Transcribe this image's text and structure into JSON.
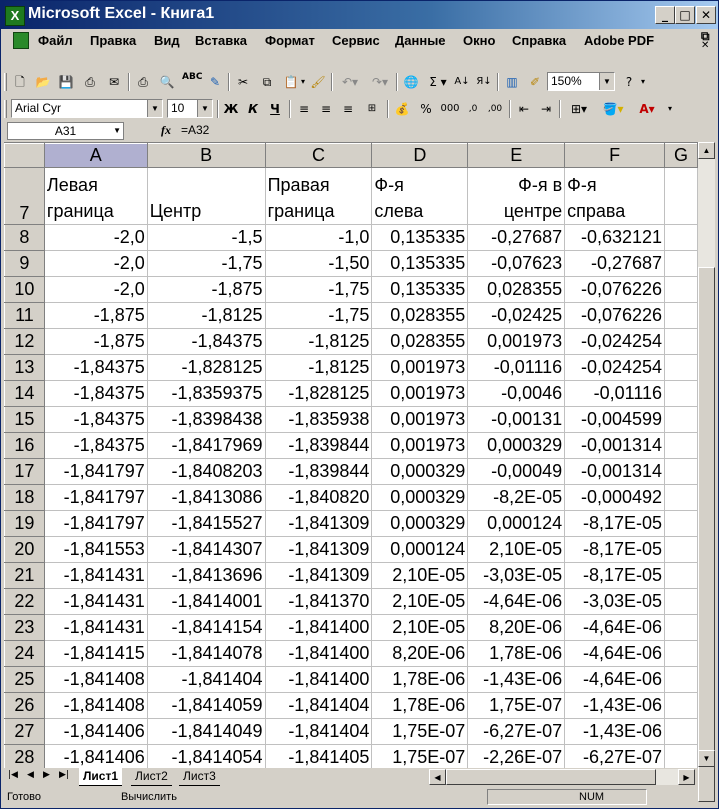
{
  "window": {
    "title": "Microsoft Excel - Книга1"
  },
  "menu": [
    {
      "label": "Файл"
    },
    {
      "label": "Правка"
    },
    {
      "label": "Вид"
    },
    {
      "label": "Вставка"
    },
    {
      "label": "Формат"
    },
    {
      "label": "Сервис"
    },
    {
      "label": "Данные"
    },
    {
      "label": "Окно"
    },
    {
      "label": "Справка"
    },
    {
      "label": "Adobe PDF"
    }
  ],
  "toolbar": {
    "zoom": "150%",
    "font_name": "Arial Cyr",
    "font_size": "10",
    "bold": "Ж",
    "italic": "К",
    "underline": "Ч"
  },
  "formula_bar": {
    "name_box": "A31",
    "fx": "fx",
    "formula": "=A32"
  },
  "columns": [
    "A",
    "B",
    "C",
    "D",
    "E",
    "F",
    "G"
  ],
  "header_row": {
    "number": "7",
    "cells": [
      {
        "l1": "Левая",
        "l2": "граница"
      },
      {
        "l1": "",
        "l2": "Центр"
      },
      {
        "l1": "Правая",
        "l2": "граница"
      },
      {
        "l1": "Ф-я",
        "l2": "слева"
      },
      {
        "l1": "Ф-я в",
        "l2": "центре"
      },
      {
        "l1": "Ф-я",
        "l2": "справа"
      }
    ]
  },
  "rows": [
    {
      "n": "8",
      "c": [
        "-2,0",
        "-1,5",
        "-1,0",
        "0,135335",
        "-0,27687",
        "-0,632121"
      ]
    },
    {
      "n": "9",
      "c": [
        "-2,0",
        "-1,75",
        "-1,50",
        "0,135335",
        "-0,07623",
        "-0,27687"
      ]
    },
    {
      "n": "10",
      "c": [
        "-2,0",
        "-1,875",
        "-1,75",
        "0,135335",
        "0,028355",
        "-0,076226"
      ]
    },
    {
      "n": "11",
      "c": [
        "-1,875",
        "-1,8125",
        "-1,75",
        "0,028355",
        "-0,02425",
        "-0,076226"
      ]
    },
    {
      "n": "12",
      "c": [
        "-1,875",
        "-1,84375",
        "-1,8125",
        "0,028355",
        "0,001973",
        "-0,024254"
      ]
    },
    {
      "n": "13",
      "c": [
        "-1,84375",
        "-1,828125",
        "-1,8125",
        "0,001973",
        "-0,01116",
        "-0,024254"
      ]
    },
    {
      "n": "14",
      "c": [
        "-1,84375",
        "-1,8359375",
        "-1,828125",
        "0,001973",
        "-0,0046",
        "-0,01116"
      ]
    },
    {
      "n": "15",
      "c": [
        "-1,84375",
        "-1,8398438",
        "-1,835938",
        "0,001973",
        "-0,00131",
        "-0,004599"
      ]
    },
    {
      "n": "16",
      "c": [
        "-1,84375",
        "-1,8417969",
        "-1,839844",
        "0,001973",
        "0,000329",
        "-0,001314"
      ]
    },
    {
      "n": "17",
      "c": [
        "-1,841797",
        "-1,8408203",
        "-1,839844",
        "0,000329",
        "-0,00049",
        "-0,001314"
      ]
    },
    {
      "n": "18",
      "c": [
        "-1,841797",
        "-1,8413086",
        "-1,840820",
        "0,000329",
        "-8,2E-05",
        "-0,000492"
      ]
    },
    {
      "n": "19",
      "c": [
        "-1,841797",
        "-1,8415527",
        "-1,841309",
        "0,000329",
        "0,000124",
        "-8,17E-05"
      ]
    },
    {
      "n": "20",
      "c": [
        "-1,841553",
        "-1,8414307",
        "-1,841309",
        "0,000124",
        "2,10E-05",
        "-8,17E-05"
      ]
    },
    {
      "n": "21",
      "c": [
        "-1,841431",
        "-1,8413696",
        "-1,841309",
        "2,10E-05",
        "-3,03E-05",
        "-8,17E-05"
      ]
    },
    {
      "n": "22",
      "c": [
        "-1,841431",
        "-1,8414001",
        "-1,841370",
        "2,10E-05",
        "-4,64E-06",
        "-3,03E-05"
      ]
    },
    {
      "n": "23",
      "c": [
        "-1,841431",
        "-1,8414154",
        "-1,841400",
        "2,10E-05",
        "8,20E-06",
        "-4,64E-06"
      ]
    },
    {
      "n": "24",
      "c": [
        "-1,841415",
        "-1,8414078",
        "-1,841400",
        "8,20E-06",
        "1,78E-06",
        "-4,64E-06"
      ]
    },
    {
      "n": "25",
      "c": [
        "-1,841408",
        "-1,841404",
        "-1,841400",
        "1,78E-06",
        "-1,43E-06",
        "-4,64E-06"
      ]
    },
    {
      "n": "26",
      "c": [
        "-1,841408",
        "-1,8414059",
        "-1,841404",
        "1,78E-06",
        "1,75E-07",
        "-1,43E-06"
      ]
    },
    {
      "n": "27",
      "c": [
        "-1,841406",
        "-1,8414049",
        "-1,841404",
        "1,75E-07",
        "-6,27E-07",
        "-1,43E-06"
      ]
    },
    {
      "n": "28",
      "c": [
        "-1,841406",
        "-1,8414054",
        "-1,841405",
        "1,75E-07",
        "-2,26E-07",
        "-6,27E-07"
      ]
    }
  ],
  "sheets": [
    "Лист1",
    "Лист2",
    "Лист3"
  ],
  "status": {
    "ready": "Готово",
    "calc": "Вычислить",
    "num": "NUM"
  }
}
